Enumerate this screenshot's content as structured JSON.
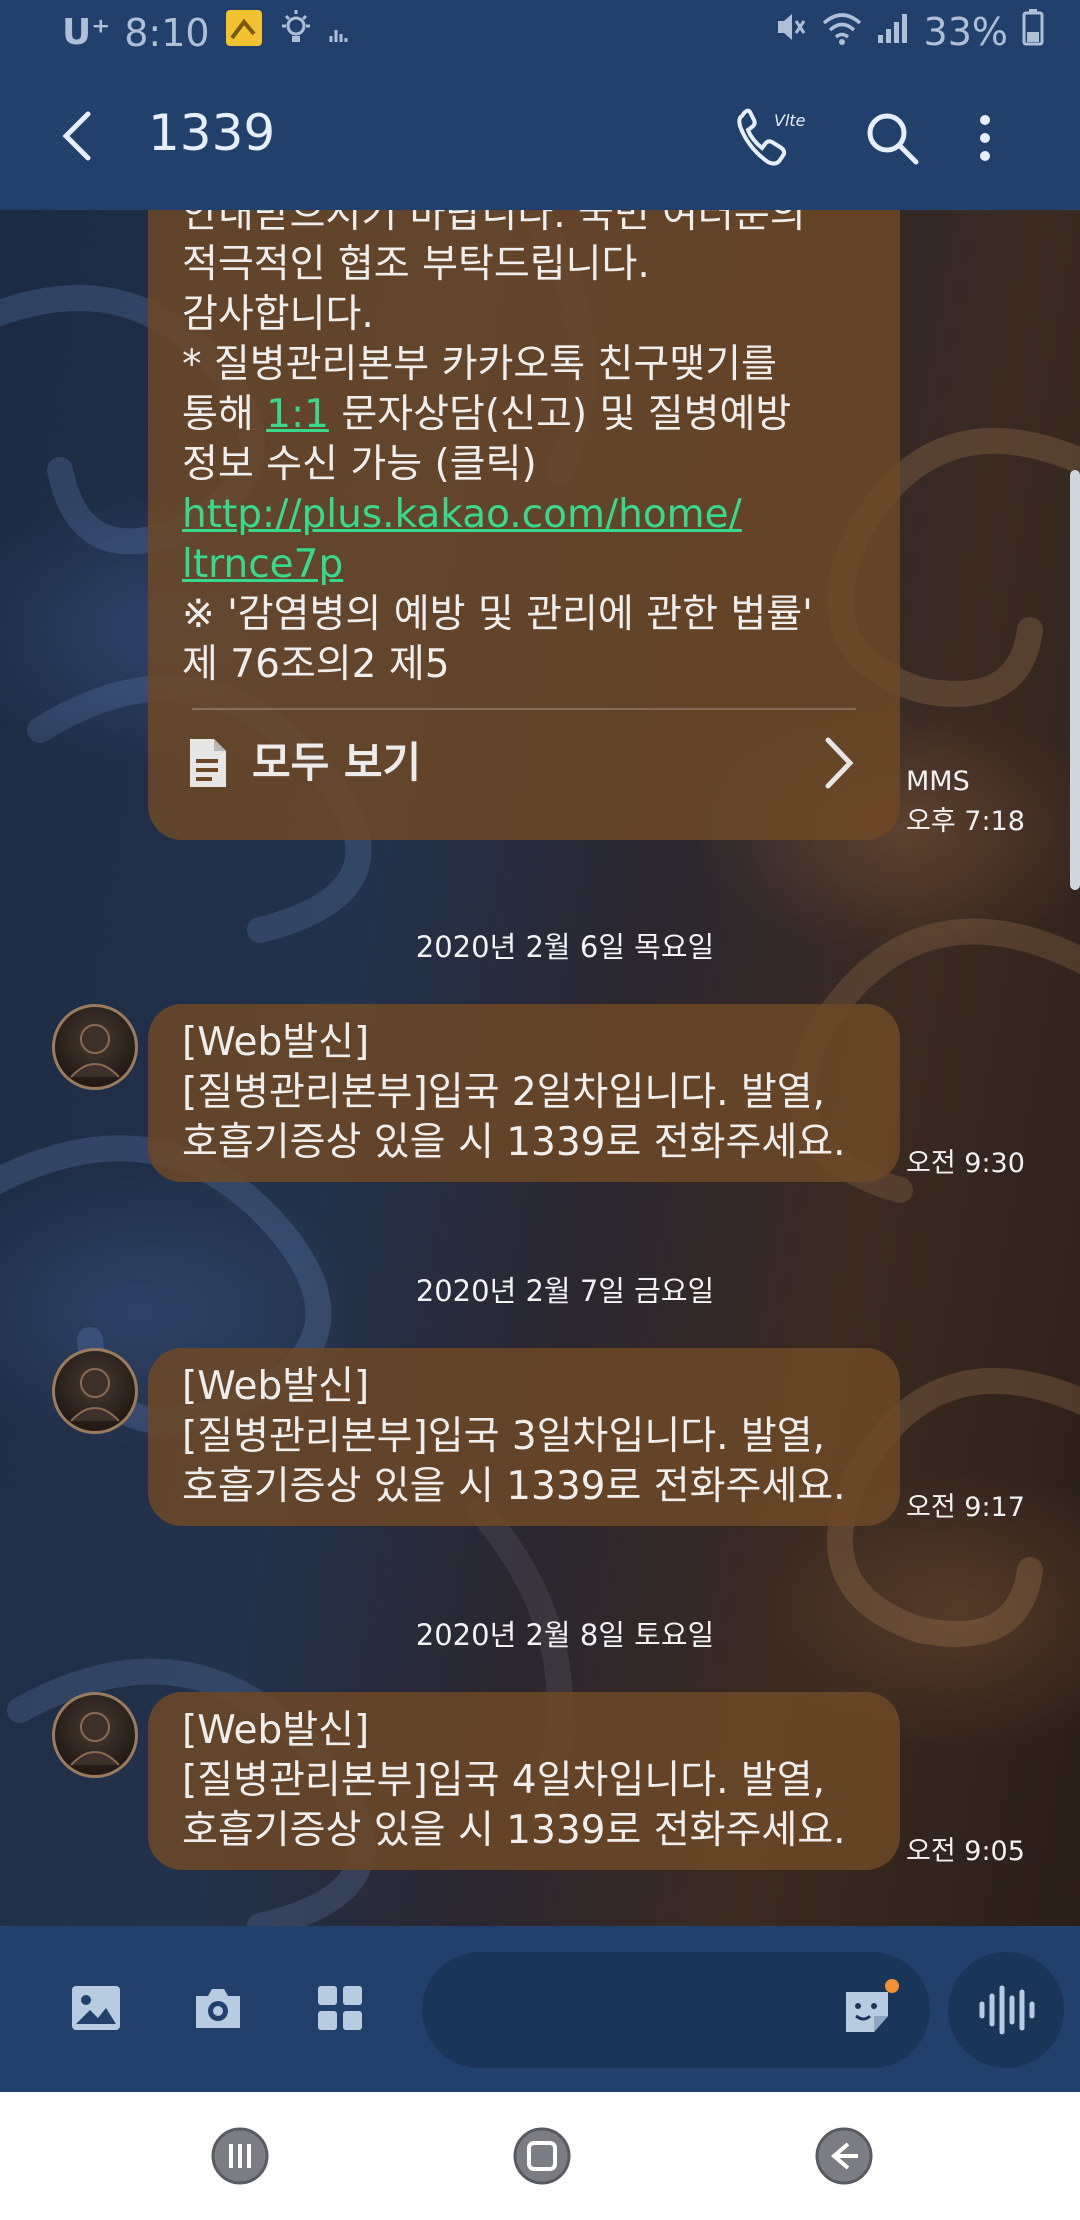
{
  "status_bar": {
    "carrier": "U⁺",
    "time": "8:10",
    "battery": "33%"
  },
  "app_bar": {
    "title": "1339",
    "icons": [
      "back-arrow-icon",
      "vlte-call-icon",
      "search-icon",
      "more-vert-icon"
    ]
  },
  "conversation": {
    "messages": [
      {
        "lines": [
          "안내받으시기 바랍니다. 국민 여러분의",
          "적극적인 협조 부탁드립니다.",
          "감사합니다.",
          "* 질병관리본부 카카오톡 친구맺기를"
        ],
        "line5_pre": "통해 ",
        "line5_link": "1:1",
        "line5_post": " 문자상담(신고) 및 질병예방",
        "line6": "정보 수신 가능 (클릭)",
        "url_part1": "http://plus.kakao.com/home/",
        "url_part2": "ltrnce7p",
        "line9": "※ '감염병의 예방 및 관리에 관한 법률'",
        "line10": "제 76조의2 제5",
        "view_all": "모두 보기",
        "type_label": "MMS",
        "time": "오후 7:18"
      },
      {
        "date": "2020년 2월 6일 목요일",
        "lines": [
          "[Web발신]",
          "[질병관리본부]입국 2일차입니다. 발열,",
          "호흡기증상 있을 시 1339로 전화주세요."
        ],
        "time": "오전 9:30"
      },
      {
        "date": "2020년 2월 7일 금요일",
        "lines": [
          "[Web발신]",
          "[질병관리본부]입국 3일차입니다. 발열,",
          "호흡기증상 있을 시 1339로 전화주세요."
        ],
        "time": "오전 9:17"
      },
      {
        "date": "2020년 2월 8일 토요일",
        "lines": [
          "[Web발신]",
          "[질병관리본부]입국 4일차입니다. 발열,",
          "호흡기증상 있을 시 1339로 전화주세요."
        ],
        "time": "오전 9:05"
      }
    ]
  },
  "composer": {
    "icons": [
      "gallery-icon",
      "camera-icon",
      "apps-grid-icon",
      "sticker-icon",
      "voice-input-icon"
    ]
  },
  "nav_bar": {
    "icons": [
      "recent-apps-icon",
      "home-icon",
      "back-icon"
    ]
  },
  "colors": {
    "bar": "#21416c",
    "bubble": "#6e4826",
    "link": "#38d98d",
    "field": "#193659"
  }
}
